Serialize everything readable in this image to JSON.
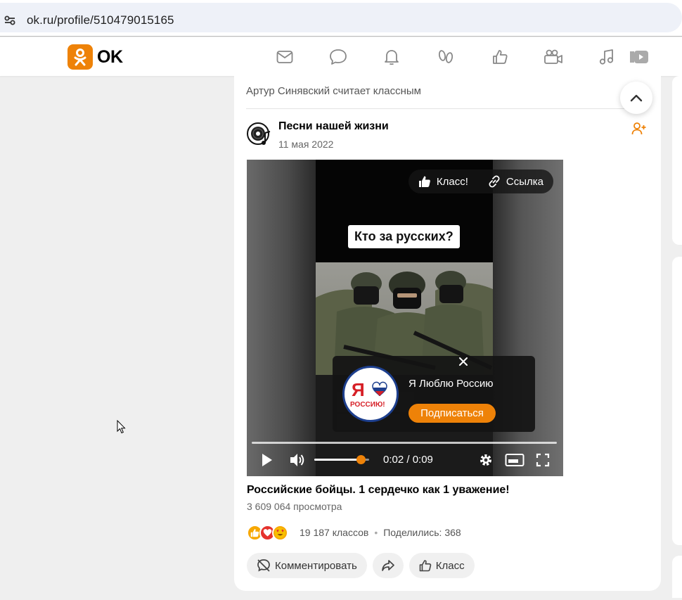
{
  "browser": {
    "url": "ok.ru/profile/510479015165"
  },
  "header": {
    "logo_text": "OK",
    "brand_color": "#ee8208",
    "nav_icons": [
      "mail-icon",
      "chat-icon",
      "bell-icon",
      "guests-icon",
      "likes-icon",
      "video-camera-icon",
      "music-icon",
      "video-icon"
    ]
  },
  "post": {
    "liked_by": "Артур Синявский считает классным",
    "group_name": "Песни нашей жизни",
    "date": "11 мая 2022",
    "video": {
      "question_caption": "Кто за русских?",
      "class_button": "Класс!",
      "link_button": "Ссылка",
      "overlay": {
        "channel_name": "Я Люблю Россию",
        "logo_text_top": "Я",
        "logo_text_bottom": "РОССИЮ!",
        "subscribe_label": "Подписаться"
      },
      "time": "0:02 / 0:09",
      "progress_fraction": 0.0,
      "volume_fraction": 0.85
    },
    "title": "Российские бойцы. 1 сердечко как 1 уважение!",
    "views": "3 609 064 просмотра",
    "reactions": [
      "like",
      "heart",
      "love-eyes"
    ],
    "likes_count": "19 187 классов",
    "separator": "•",
    "shares": "Поделились: 368",
    "actions": {
      "comment": "Комментировать",
      "like": "Класс"
    }
  }
}
